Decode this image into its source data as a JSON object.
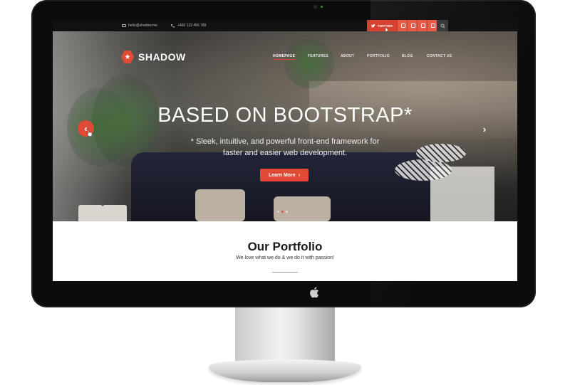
{
  "topbar": {
    "email": "hello@shadow.me",
    "phone": "+460 123 456 789",
    "twitter_label": "TWITTER",
    "social_icons": [
      "facebook-icon",
      "google-plus-icon",
      "linkedin-icon",
      "rss-icon"
    ],
    "search_icon": "search-icon"
  },
  "brand": {
    "name": "SHADOW",
    "accent": "#e04a36"
  },
  "nav": {
    "items": [
      {
        "label": "HOMEPAGE",
        "active": true
      },
      {
        "label": "FEATURES",
        "active": false
      },
      {
        "label": "ABOUT",
        "active": false
      },
      {
        "label": "PORTFOLIO",
        "active": false
      },
      {
        "label": "BLOG",
        "active": false
      },
      {
        "label": "CONTACT US",
        "active": false
      }
    ]
  },
  "hero": {
    "headline": "BASED ON BOOTSTRAP*",
    "subline_1": "* Sleek, intuitive, and powerful front-end framework for",
    "subline_2": "faster and easier web development.",
    "cta_label": "Learn More",
    "cta_icon": "chevron-right-icon",
    "prev_icon": "chevron-left-icon",
    "next_icon": "chevron-right-icon",
    "slides": 3,
    "active_slide": 2
  },
  "portfolio": {
    "title": "Our Portfolio",
    "subtitle": "We love what we do & we do it with passion!"
  }
}
